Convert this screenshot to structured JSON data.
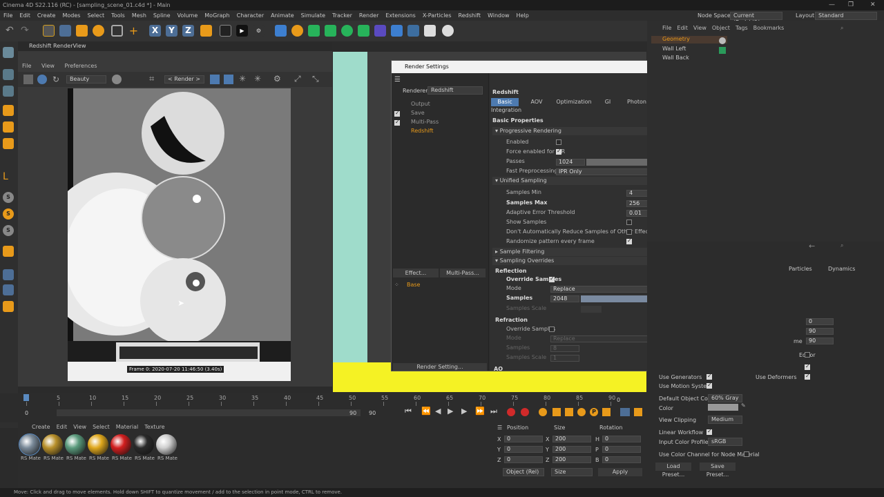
{
  "app": {
    "title": "Cinema 4D S22.116 (RC) - [sampling_scene_01.c4d *] - Main",
    "node_space_label": "Node Space:",
    "node_space_value": "Current (Redshift)",
    "layout_label": "Layout:",
    "layout_value": "Standard"
  },
  "menu": [
    "File",
    "Edit",
    "Create",
    "Modes",
    "Select",
    "Tools",
    "Mesh",
    "Spline",
    "Volume",
    "MoGraph",
    "Character",
    "Animate",
    "Simulate",
    "Tracker",
    "Render",
    "Extensions",
    "X-Particles",
    "Redshift",
    "Window",
    "Help"
  ],
  "render_view": {
    "title": "Redshift RenderView",
    "menu": [
      "File",
      "View",
      "Preferences"
    ],
    "aov": "Beauty",
    "render_mode": "< Render >",
    "caption": "Frame  0:  2020-07-20  11:46:50  (3.40s)"
  },
  "render_settings": {
    "title": "Render Settings",
    "renderer_label": "Renderer",
    "renderer_value": "Redshift",
    "tree": [
      {
        "label": "Output",
        "checked": false
      },
      {
        "label": "Save",
        "checked": true
      },
      {
        "label": "Multi-Pass",
        "checked": true
      },
      {
        "label": "Redshift",
        "checked": false
      }
    ],
    "effect_button": "Effect...",
    "multipass_button": "Multi-Pass...",
    "base_item": "Base",
    "footer_button": "Render Setting...",
    "panel_title": "Redshift",
    "tabs": [
      "Basic",
      "AOV",
      "Optimization",
      "GI",
      "Photon",
      "SSS",
      "System",
      "Memory",
      "Integration"
    ],
    "basic_properties": "Basic Properties",
    "progressive": {
      "header": "Progressive Rendering",
      "enabled_label": "Enabled",
      "force_label": "Force enabled for IPR",
      "passes_label": "Passes",
      "passes_value": "1024",
      "fast_label": "Fast Preprocessing",
      "fast_value": "IPR Only"
    },
    "unified": {
      "header": "Unified Sampling",
      "min_label": "Samples Min",
      "min_value": "4",
      "min_fill": 0.01,
      "max_label": "Samples Max",
      "max_value": "256",
      "max_fill": 0.25,
      "aet_label": "Adaptive Error Threshold",
      "aet_value": "0.01",
      "aet_fill": 0.01,
      "show_label": "Show Samples",
      "dont_label": "Don't Automatically Reduce Samples of Other Effects",
      "rand_label": "Randomize pattern every frame"
    },
    "filtering_header": "Sample Filtering",
    "overrides_header": "Sampling Overrides",
    "reflection": {
      "header": "Reflection",
      "override_label": "Override Samples",
      "mode_label": "Mode",
      "mode_value": "Replace",
      "samples_label": "Samples",
      "samples_value": "2048",
      "samples_fill": 1.0,
      "scale_label": "Samples Scale"
    },
    "refraction": {
      "header": "Refraction",
      "override_label": "Override Samples",
      "mode_label": "Mode",
      "mode_value": "Replace",
      "samples_label": "Samples",
      "samples_value": "8",
      "scale_label": "Samples Scale",
      "scale_value": "1"
    },
    "ao_header": "AO"
  },
  "objects": {
    "menu": [
      "File",
      "Edit",
      "View",
      "Object",
      "Tags",
      "Bookmarks"
    ],
    "items": [
      "Geometry",
      "Wall Left",
      "Wall Back"
    ]
  },
  "attributes": {
    "tabs": [
      "Particles",
      "Dynamics"
    ],
    "values": [
      "0",
      "90",
      "90"
    ],
    "editor_label": "Editor",
    "use_generators": "Use Generators",
    "use_deformers": "Use Deformers",
    "use_motion": "Use Motion System",
    "default_color_label": "Default Object Color",
    "default_color_value": "60% Gray",
    "color_label": "Color",
    "view_clipping_label": "View Clipping",
    "view_clipping_value": "Medium",
    "linear_label": "Linear Workflow",
    "profile_label": "Input Color Profile",
    "profile_value": "sRGB",
    "use_channel": "Use Color Channel for Node Material",
    "load_preset": "Load Preset...",
    "save_preset": "Save Preset...",
    "frag_me": "me"
  },
  "timeline": {
    "ticks": [
      "0",
      "5",
      "10",
      "15",
      "20",
      "25",
      "30",
      "35",
      "40",
      "45",
      "50",
      "55",
      "60",
      "65",
      "70",
      "75",
      "80",
      "85",
      "90"
    ],
    "start": "0",
    "start2": "0",
    "end": "90",
    "end2": "90",
    "current": "0"
  },
  "materials": {
    "menu": [
      "Create",
      "Edit",
      "View",
      "Select",
      "Material",
      "Texture"
    ],
    "label": "RS Mate",
    "colors": [
      "#7a8a99",
      "#b8902a",
      "#5a9a7c",
      "#e0a81c",
      "#d21e1e",
      "#2a2a2a",
      "#cfcfcf"
    ]
  },
  "coords": {
    "headers": [
      "Position",
      "Size",
      "Rotation"
    ],
    "rows": [
      {
        "a": "X",
        "av": "0",
        "b": "X",
        "bv": "200",
        "c": "H",
        "cv": "0"
      },
      {
        "a": "Y",
        "av": "0",
        "b": "Y",
        "bv": "200",
        "c": "P",
        "cv": "0"
      },
      {
        "a": "Z",
        "av": "0",
        "b": "Z",
        "bv": "200",
        "c": "B",
        "cv": "0"
      }
    ],
    "mode1": "Object (Rel)",
    "mode2": "Size",
    "apply": "Apply"
  },
  "status": "Move: Click and drag to move elements. Hold down SHIFT to quantize movement / add to the selection in point mode, CTRL to remove.",
  "icons": [
    "undo-icon",
    "redo-icon",
    "move-icon",
    "scale-icon",
    "rotate-icon",
    "x-axis-icon",
    "y-axis-icon",
    "z-axis-icon",
    "render-icon",
    "cube-icon",
    "light-icon"
  ]
}
